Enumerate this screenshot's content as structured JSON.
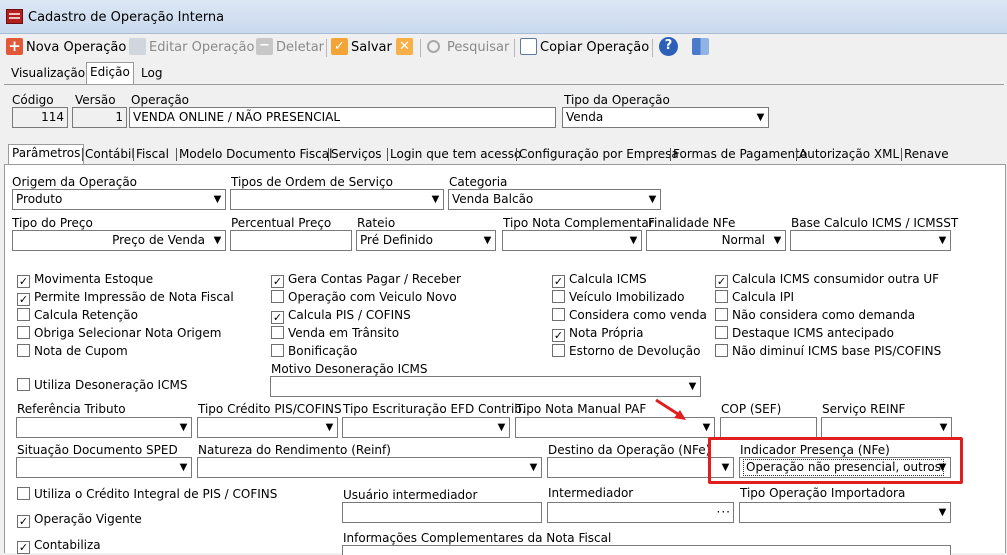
{
  "window": {
    "title": "Cadastro de Operação Interna",
    "icon": "app-icon"
  },
  "toolbar": {
    "nova": "Nova Operação",
    "editar": "Editar Operação",
    "deletar": "Deletar",
    "salvar": "Salvar",
    "pesquisar": "Pesquisar",
    "copiar": "Copiar Operação"
  },
  "main_tabs": [
    "Visualização",
    "Edição",
    "Log"
  ],
  "header": {
    "codigo_label": "Código",
    "codigo": "114",
    "versao_label": "Versão",
    "versao": "1",
    "operacao_label": "Operação",
    "operacao": "VENDA ONLINE / NÃO PRESENCIAL",
    "tipo_label": "Tipo da Operação",
    "tipo": "Venda"
  },
  "sub_tabs": [
    "Parâmetros",
    "Contábil",
    "Fiscal",
    "Modelo Documento Fiscal",
    "Serviços",
    "Login que tem acesso",
    "Configuração por Empresa",
    "Formas de Pagamento",
    "Autorização XML",
    "Renave"
  ],
  "fields": {
    "origem_label": "Origem da Operação",
    "origem": "Produto",
    "tipos_os_label": "Tipos de Ordem de Serviço",
    "tipos_os": "",
    "categoria_label": "Categoria",
    "categoria": "Venda Balcão",
    "tipo_preco_label": "Tipo do Preço",
    "tipo_preco": "Preço de Venda",
    "perc_preco_label": "Percentual Preço",
    "perc_preco": "",
    "rateio_label": "Rateio",
    "rateio": "Pré Definido",
    "nota_compl_label": "Tipo Nota Complementar",
    "finalidade_label": "Finalidade NFe",
    "finalidade": "Normal",
    "base_icms_label": "Base Calculo ICMS / ICMSST",
    "motivo_deson_label": "Motivo Desoneração ICMS",
    "ref_trib_label": "Referência Tributo",
    "tipo_cred_label": "Tipo Crédito PIS/COFINS",
    "tipo_escr_label": "Tipo Escrituração EFD Contrib.",
    "tipo_nota_paf_label": "Tipo Nota Manual PAF",
    "cop_label": "COP (SEF)",
    "servico_reinf_label": "Serviço REINF",
    "sit_doc_label": "Situação Documento SPED",
    "nat_rend_label": "Natureza do Rendimento (Reinf)",
    "destino_label": "Destino da Operação (NFe)",
    "ind_presenca_label": "Indicador Presença (NFe)",
    "ind_presenca": "Operação não presencial, outros",
    "usuario_int_label": "Usuário intermediador",
    "intermediador_label": "Intermediador",
    "tipo_op_import_label": "Tipo Operação Importadora",
    "info_compl_label": "Informações Complementares da Nota Fiscal"
  },
  "checkboxes": {
    "col1": [
      {
        "label": "Movimenta Estoque",
        "checked": true
      },
      {
        "label": "Permite Impressão de Nota Fiscal",
        "checked": true
      },
      {
        "label": "Calcula Retenção",
        "checked": false
      },
      {
        "label": "Obriga Selecionar Nota Origem",
        "checked": false
      },
      {
        "label": "Nota de Cupom",
        "checked": false
      }
    ],
    "col2": [
      {
        "label": "Gera Contas Pagar / Receber",
        "checked": true
      },
      {
        "label": "Operação com Veiculo Novo",
        "checked": false
      },
      {
        "label": "Calcula PIS / COFINS",
        "checked": true
      },
      {
        "label": "Venda em Trânsito",
        "checked": false
      },
      {
        "label": "Bonificação",
        "checked": false
      }
    ],
    "col3": [
      {
        "label": "Calcula ICMS",
        "checked": true
      },
      {
        "label": "Veículo Imobilizado",
        "checked": false
      },
      {
        "label": "Considera como venda",
        "checked": false
      },
      {
        "label": "Nota Própria",
        "checked": true
      },
      {
        "label": "Estorno de Devolução",
        "checked": false
      }
    ],
    "col4": [
      {
        "label": "Calcula ICMS consumidor outra UF",
        "checked": true
      },
      {
        "label": "Calcula IPI",
        "checked": false
      },
      {
        "label": "Não considera como demanda",
        "checked": false
      },
      {
        "label": "Destaque ICMS antecipado",
        "checked": false
      },
      {
        "label": "Não diminuí ICMS base PIS/COFINS",
        "checked": false
      }
    ],
    "utiliza_deson": {
      "label": "Utiliza Desoneração ICMS",
      "checked": false
    },
    "credito_integral": {
      "label": "Utiliza o Crédito Integral de PIS / COFINS",
      "checked": false
    },
    "vigente": {
      "label": "Operação Vigente",
      "checked": true
    },
    "contabiliza": {
      "label": "Contabiliza",
      "checked": true
    }
  },
  "colors": {
    "highlight": "#e21d1d",
    "titlebar": "#dce7f5"
  }
}
